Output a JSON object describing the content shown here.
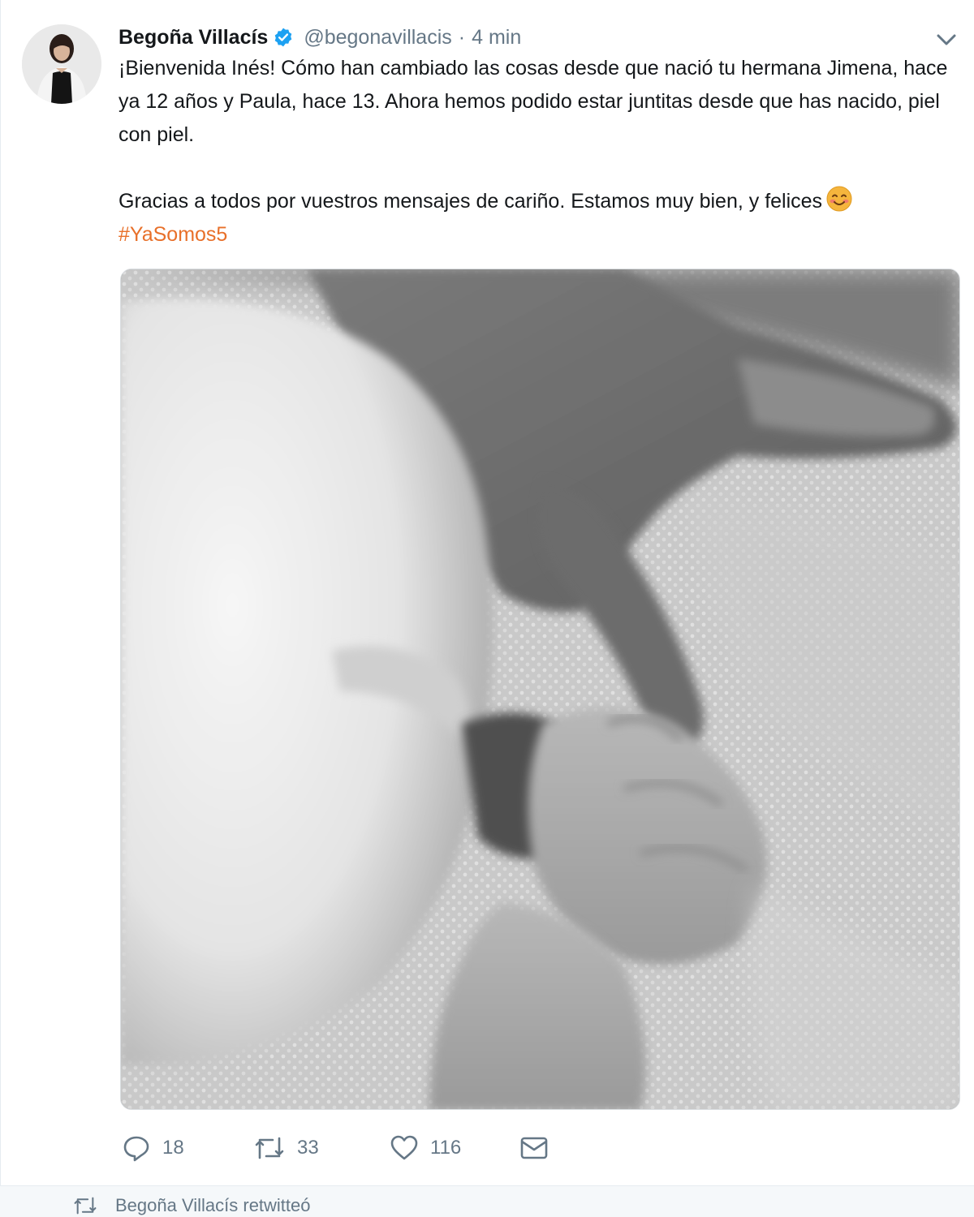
{
  "tweet": {
    "author_name": "Begoña Villacís",
    "handle": "@begonavillacis",
    "separator": "·",
    "time": "4 min",
    "text_line1": "¡Bienvenida Inés! Cómo han cambiado las cosas desde que nació tu hermana Jimena, hace ya 12 años y Paula, hace 13. Ahora hemos podido estar juntitas desde que has nacido, piel con piel.",
    "text_line2": "Gracias a todos por vuestros mensajes de cariño. Estamos muy bien, y felices",
    "hashtag": "#YaSomos5",
    "emoji": "smiling-face-with-smiling-eyes"
  },
  "actions": {
    "replies": "18",
    "retweets": "33",
    "likes": "116"
  },
  "icons": {
    "verified": "verified-badge-icon",
    "caret": "chevron-down-icon",
    "reply": "reply-icon",
    "retweet": "retweet-icon",
    "like": "heart-icon",
    "dm": "envelope-icon"
  },
  "next_item": {
    "retweet_label": "Begoña Villacís retwitteó"
  },
  "colors": {
    "hashtag": "#e8702a",
    "verified": "#1da1f2",
    "muted": "#657786"
  }
}
